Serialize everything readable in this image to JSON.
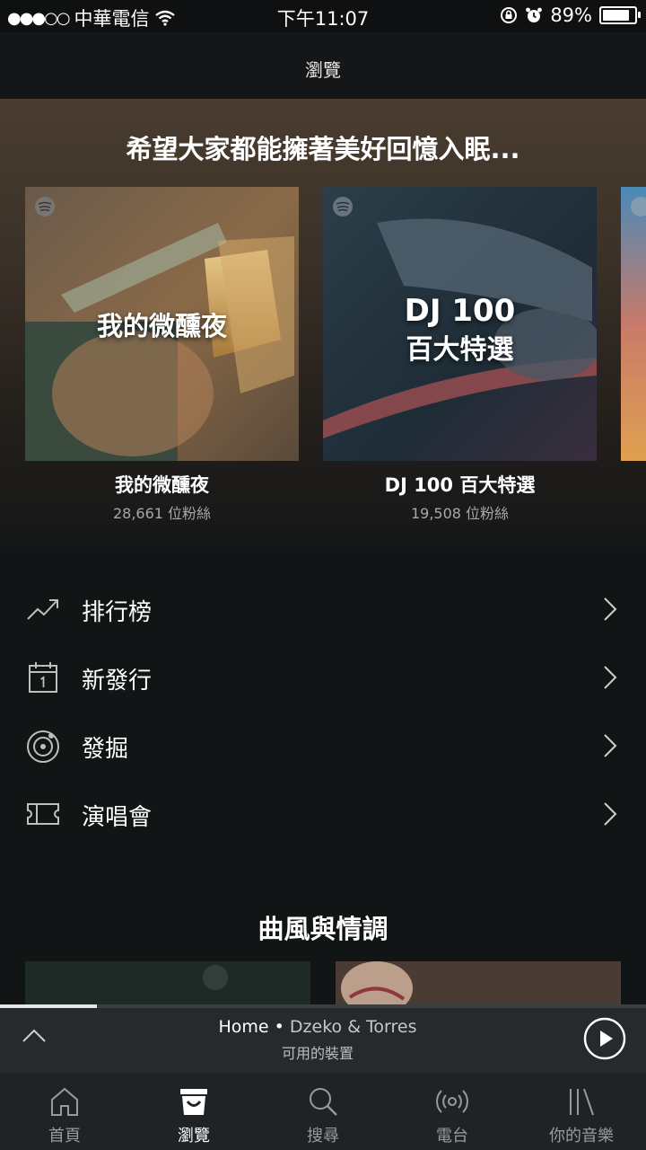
{
  "status_bar": {
    "signal": "●●●○○",
    "carrier": "中華電信",
    "time": "下午11:07",
    "battery": "89%",
    "battery_level": 0.89
  },
  "nav": {
    "title": "瀏覽"
  },
  "hero": {
    "title": "希望大家都能擁著美好回憶入眠...",
    "cards": [
      {
        "art_text": "我的微醺夜",
        "name": "我的微醺夜",
        "followers": "28,661 位粉絲"
      },
      {
        "art_text_line1": "DJ 100",
        "art_text_line2": "百大特選",
        "name": "DJ 100 百大特選",
        "followers": "19,508 位粉絲"
      }
    ]
  },
  "menu": [
    {
      "label": "排行榜",
      "icon": "trending-up-icon"
    },
    {
      "label": "新發行",
      "icon": "calendar-icon"
    },
    {
      "label": "發掘",
      "icon": "discover-icon"
    },
    {
      "label": "演唱會",
      "icon": "ticket-icon"
    }
  ],
  "section": {
    "title": "曲風與情調"
  },
  "player": {
    "device": "Home",
    "separator": "•",
    "track": "Dzeko & Torres",
    "subtitle": "可用的裝置",
    "progress": 0.15
  },
  "tabs": [
    {
      "label": "首頁",
      "icon": "home-icon",
      "active": false
    },
    {
      "label": "瀏覽",
      "icon": "browse-icon",
      "active": true
    },
    {
      "label": "搜尋",
      "icon": "search-icon",
      "active": false
    },
    {
      "label": "電台",
      "icon": "radio-icon",
      "active": false
    },
    {
      "label": "你的音樂",
      "icon": "library-icon",
      "active": false
    }
  ],
  "colors": {
    "background": "#121516",
    "accent": "#1db954",
    "tab_active": "#ffffff",
    "tab_inactive": "#9a9a9a"
  }
}
